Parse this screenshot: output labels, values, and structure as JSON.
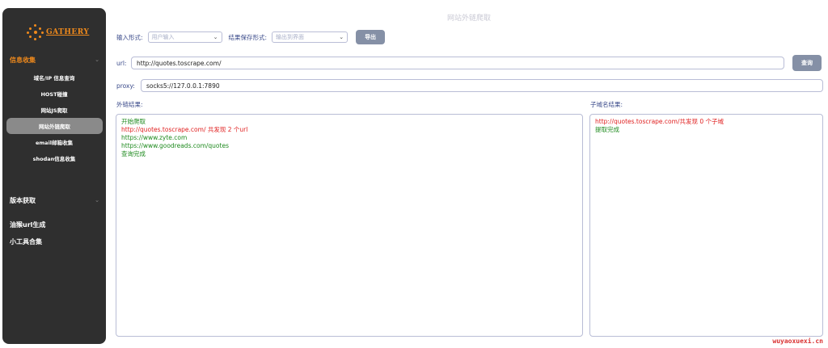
{
  "sidebar": {
    "logo_text": "GATHERY",
    "groups": [
      {
        "label": "信息收集",
        "expanded": true,
        "items": [
          {
            "label": "域名/IP 信息查询"
          },
          {
            "label": "HOST碰撞"
          },
          {
            "label": "网站JS爬取"
          },
          {
            "label": "网站外链爬取",
            "selected": true
          },
          {
            "label": "email邮箱收集"
          },
          {
            "label": "shodan信息收集"
          }
        ]
      },
      {
        "label": "版本获取"
      },
      {
        "label": "油猴url生成"
      },
      {
        "label": "小工具合集"
      }
    ]
  },
  "page": {
    "title": "网站外链爬取"
  },
  "controls": {
    "input_mode_label": "输入形式:",
    "input_mode_value": "用户输入",
    "save_mode_label": "结果保存形式:",
    "save_mode_value": "输出到界面",
    "export_button": "导出",
    "url_label": "url:",
    "url_value": "http://quotes.toscrape.com/",
    "query_button": "查询",
    "proxy_label": "proxy:",
    "proxy_value": "socks5://127.0.0.1:7890"
  },
  "results": {
    "outlink_label": "外链结果:",
    "outlink_lines": [
      {
        "text": "开始爬取",
        "color": "green"
      },
      {
        "text": "http://quotes.toscrape.com/ 共发现 2 个url",
        "color": "red"
      },
      {
        "text": "https://www.zyte.com",
        "color": "green"
      },
      {
        "text": "https://www.goodreads.com/quotes",
        "color": "green"
      },
      {
        "text": "查询完成",
        "color": "green"
      }
    ],
    "subdomain_label": "子域名结果:",
    "subdomain_lines": [
      {
        "text": "http://quotes.toscrape.com/共发现 0 个子域",
        "color": "red"
      },
      {
        "text": "提取完成",
        "color": "green"
      }
    ]
  },
  "watermark": "wuyaoxuexi.cn",
  "colors": {
    "accent": "#f08a1c",
    "sidebar_bg": "#2f2f2f",
    "button": "#8590a6",
    "ok": "#1e8a1e",
    "error": "#e02020"
  }
}
